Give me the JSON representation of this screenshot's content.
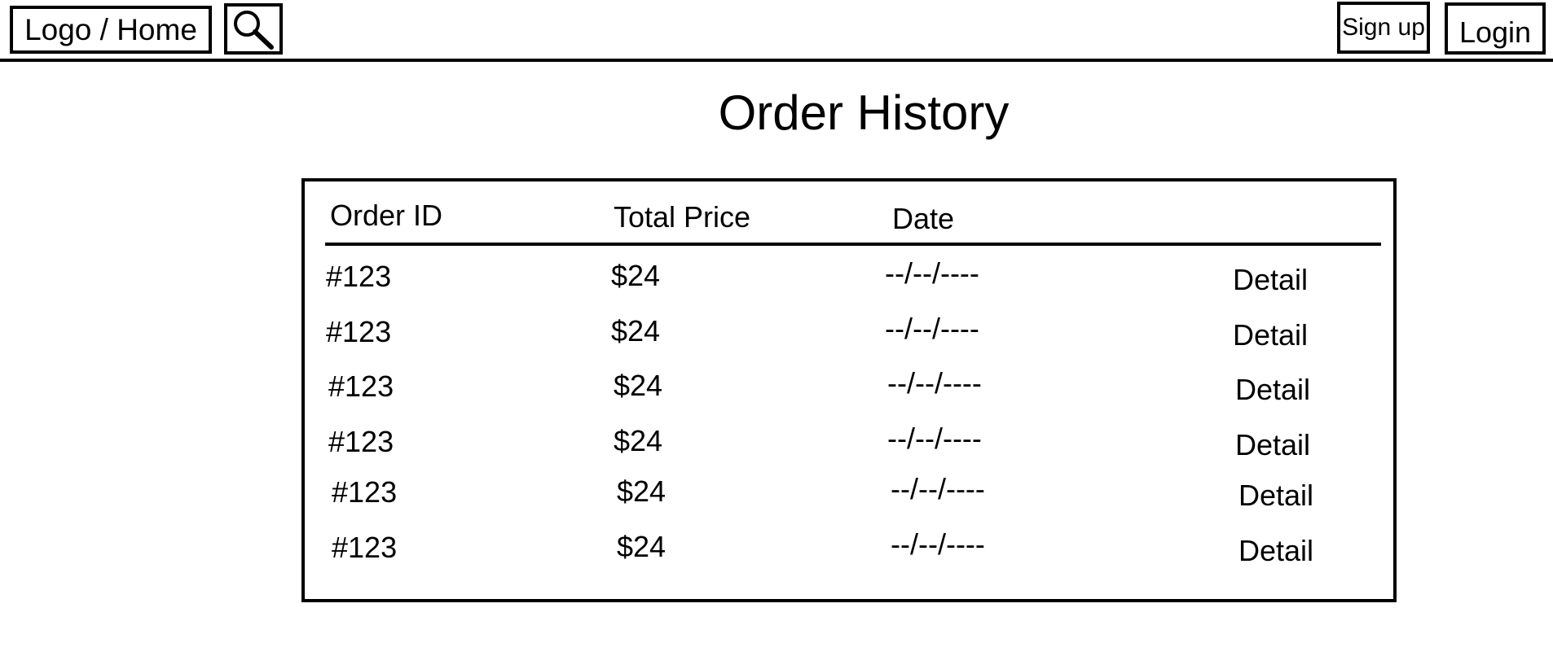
{
  "header": {
    "logo_label": "Logo / Home",
    "search_icon": "search-icon",
    "signup_label": "Sign up",
    "login_label": "Login"
  },
  "page": {
    "title": "Order History"
  },
  "table": {
    "columns": [
      "Order ID",
      "Total Price",
      "Date"
    ],
    "rows": [
      {
        "id": "#123",
        "price": "$24",
        "date": "--/--/----",
        "action": "Detail"
      },
      {
        "id": "#123",
        "price": "$24",
        "date": "--/--/----",
        "action": "Detail"
      },
      {
        "id": "#123",
        "price": "$24",
        "date": "--/--/----",
        "action": "Detail"
      },
      {
        "id": "#123",
        "price": "$24",
        "date": "--/--/----",
        "action": "Detail"
      },
      {
        "id": "#123",
        "price": "$24",
        "date": "--/--/----",
        "action": "Detail"
      },
      {
        "id": "#123",
        "price": "$24",
        "date": "--/--/----",
        "action": "Detail"
      }
    ]
  },
  "colors": {
    "ink": "#000000",
    "background": "#ffffff"
  }
}
